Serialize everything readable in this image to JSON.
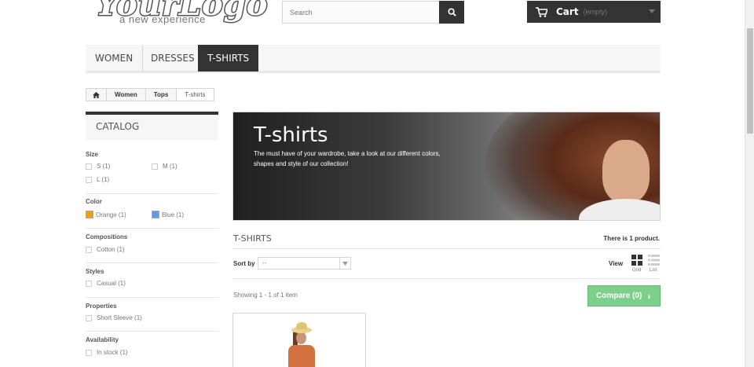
{
  "header": {
    "logo_main": "YourLogo",
    "logo_sub": "a new experience",
    "search": {
      "placeholder": "Search",
      "icon": "search-icon"
    },
    "cart": {
      "label": "Cart",
      "status": "(empty)",
      "icon": "cart-icon"
    }
  },
  "menu": {
    "items": [
      {
        "label": "WOMEN"
      },
      {
        "label": "DRESSES"
      },
      {
        "label": "T-SHIRTS",
        "active": true
      }
    ]
  },
  "breadcrumb": {
    "home_icon": "home-icon",
    "items": [
      "Women",
      "Tops",
      "T-shirts"
    ]
  },
  "sidebar": {
    "title": "CATALOG",
    "filters": {
      "size": {
        "title": "Size",
        "options": [
          "S (1)",
          "M (1)",
          "L (1)"
        ]
      },
      "color": {
        "title": "Color",
        "options": [
          {
            "label": "Orange (1)",
            "color": "#f39c11"
          },
          {
            "label": "Blue (1)",
            "color": "#5d9cec"
          }
        ]
      },
      "compositions": {
        "title": "Compositions",
        "options": [
          "Cotton (1)"
        ]
      },
      "styles": {
        "title": "Styles",
        "options": [
          "Casual (1)"
        ]
      },
      "properties": {
        "title": "Properties",
        "options": [
          "Short Sleeve (1)"
        ]
      },
      "availability": {
        "title": "Availability",
        "options": [
          "In stock (1)"
        ]
      }
    }
  },
  "banner": {
    "title": "T-shirts",
    "description": "The must have of your wardrobe, take a look at our different colors, shapes and style of our collection!"
  },
  "listing": {
    "heading": "T-SHIRTS",
    "count": "There is 1 product.",
    "sort_label": "Sort by",
    "sort_value": "--",
    "view_label": "View",
    "view_grid": "Grid",
    "view_list": "List",
    "showing": "Showing 1 - 1 of 1 item",
    "compare": "Compare (0)"
  },
  "colors": {
    "dark": "#333333",
    "compare_green": "#7dd08b"
  }
}
